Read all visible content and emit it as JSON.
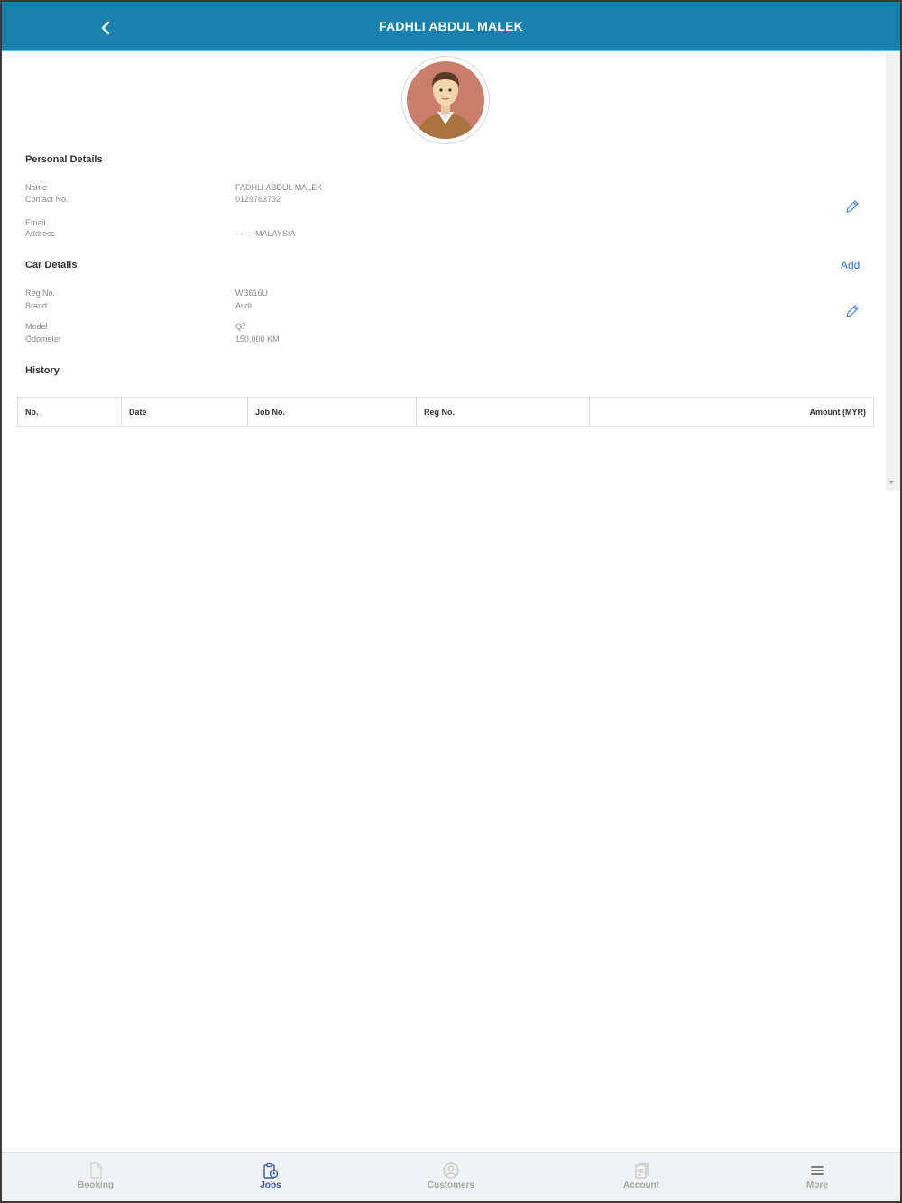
{
  "header": {
    "title": "FADHLI ABDUL MALEK"
  },
  "personal": {
    "title": "Personal Details",
    "name_label": "Name",
    "name_value": "FADHLI ABDUL MALEK",
    "contact_label": "Contact No.",
    "contact_value": "0129763732",
    "email_label": "Email",
    "address_label": "Address",
    "address_value": "- - - - MALAYSIA"
  },
  "car": {
    "title": "Car Details",
    "add_label": "Add",
    "reg_label": "Reg No.",
    "reg_value": "WB616U",
    "brand_label": "Brand",
    "brand_value": "Audi",
    "model_label": "Model",
    "model_value": "Q7",
    "odometer_label": "Odometer",
    "odometer_value": "150,000 KM"
  },
  "history": {
    "title": "History",
    "columns": [
      "No.",
      "Date",
      "Job No.",
      "Reg No.",
      "Amount (MYR)"
    ]
  },
  "nav": {
    "items": [
      {
        "label": "Booking",
        "icon": "document-icon"
      },
      {
        "label": "Jobs",
        "icon": "clipboard-clock-icon"
      },
      {
        "label": "Customers",
        "icon": "user-circle-icon"
      },
      {
        "label": "Account",
        "icon": "receipt-icon"
      },
      {
        "label": "More",
        "icon": "hamburger-icon"
      }
    ],
    "active": "Jobs"
  },
  "colors": {
    "header": "#1682ad",
    "accent": "#2a6fe0",
    "active_nav": "#3a5b9c"
  }
}
